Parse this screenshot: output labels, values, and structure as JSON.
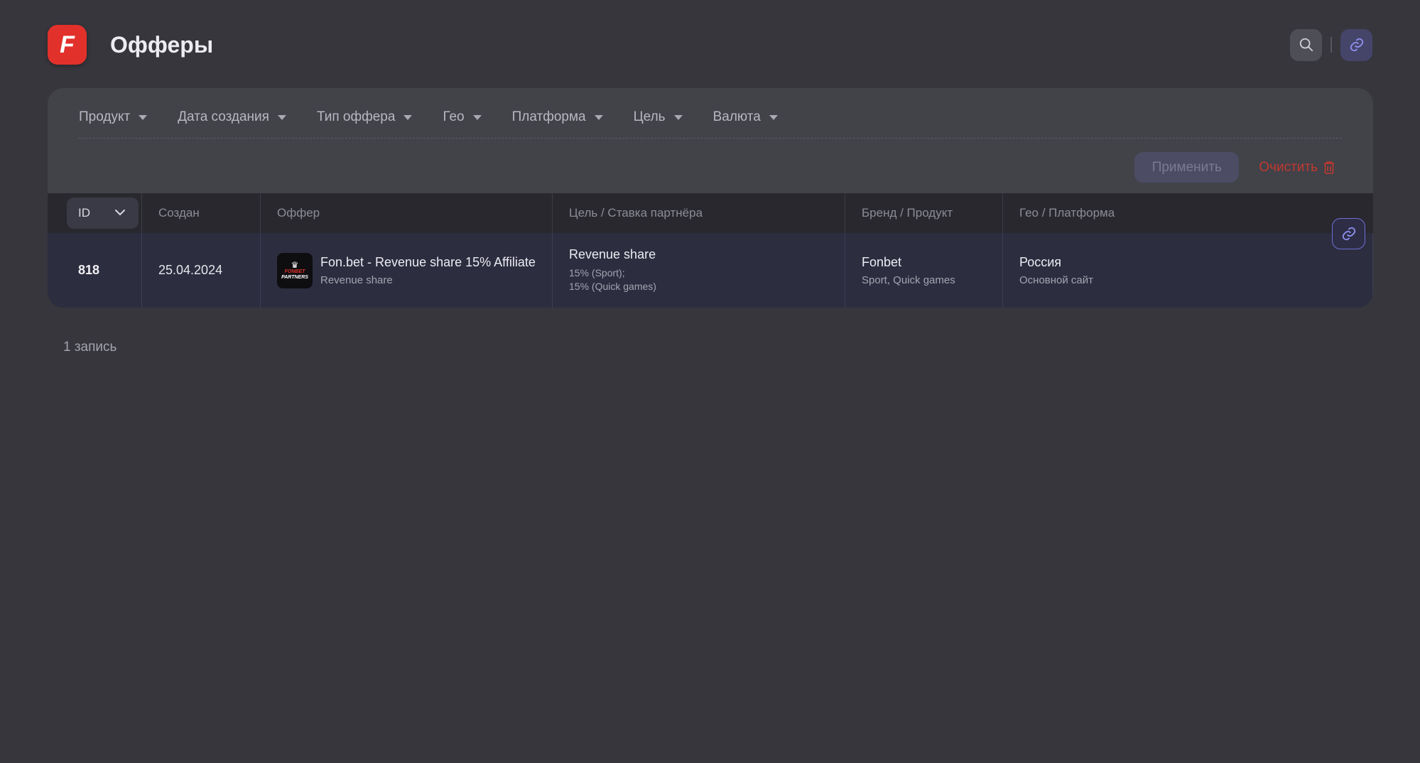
{
  "header": {
    "logo_letter": "F",
    "title": "Офферы",
    "search_icon": "search-icon",
    "link_icon": "link-icon"
  },
  "filters": {
    "items": [
      {
        "label": "Продукт"
      },
      {
        "label": "Дата создания"
      },
      {
        "label": "Тип оффера"
      },
      {
        "label": "Гео"
      },
      {
        "label": "Платформа"
      },
      {
        "label": "Цель"
      },
      {
        "label": "Валюта"
      }
    ],
    "apply_label": "Применить",
    "clear_label": "Очистить"
  },
  "table": {
    "sort_select": "ID",
    "columns": [
      "Создан",
      "Оффер",
      "Цель / Ставка партнёра",
      "Бренд / Продукт",
      "Гео / Платформа"
    ],
    "rows": [
      {
        "id": "818",
        "created": "25.04.2024",
        "offer_logo_top": "FONBET",
        "offer_logo_bottom": "PARTNERS",
        "offer_title": "Fon.bet - Revenue share 15% Affiliate",
        "offer_type": "Revenue share",
        "goal": "Revenue share",
        "rate_lines": [
          "15% (Sport);",
          "15% (Quick games)"
        ],
        "brand": "Fonbet",
        "products": "Sport, Quick games",
        "geo": "Россия",
        "platform": "Основной сайт"
      }
    ]
  },
  "footer": {
    "count_label": "1 запись"
  },
  "colors": {
    "background": "#36363c",
    "panel": "#424249",
    "accent_red": "#e2312b",
    "accent_purple": "#6f6fd6"
  }
}
